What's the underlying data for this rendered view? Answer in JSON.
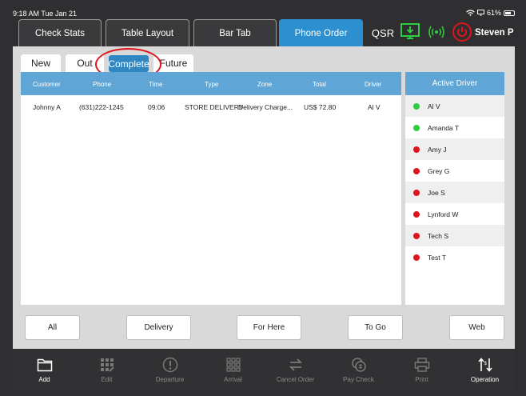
{
  "status_bar": {
    "time_date": "9:18 AM  Tue Jan 21",
    "battery": "61%"
  },
  "top_tabs": [
    {
      "label": "Check Stats",
      "active": false
    },
    {
      "label": "Table Layout",
      "active": false
    },
    {
      "label": "Bar Tab",
      "active": false
    },
    {
      "label": "Phone Order",
      "active": true
    }
  ],
  "qsr_label": "QSR",
  "user_name": "Steven P",
  "sub_tabs": [
    {
      "label": "New",
      "active": false
    },
    {
      "label": "Out",
      "active": false
    },
    {
      "label": "Complete",
      "active": true
    },
    {
      "label": "Future",
      "active": false
    }
  ],
  "orders_table": {
    "headers": [
      "Customer",
      "Phone",
      "Time",
      "Type",
      "Zone",
      "Total",
      "Driver"
    ],
    "rows": [
      [
        "Johnny A",
        "(631)222-1245",
        "09:06",
        "STORE DELIVERY",
        "Delivery Charge...",
        "US$ 72.80",
        "Al V"
      ]
    ]
  },
  "active_driver": {
    "title": "Active Driver",
    "drivers": [
      {
        "name": "Al V",
        "status": "active"
      },
      {
        "name": "Amanda T",
        "status": "active"
      },
      {
        "name": "Amy J",
        "status": "inactive"
      },
      {
        "name": "Grey G",
        "status": "inactive"
      },
      {
        "name": "Joe S",
        "status": "inactive"
      },
      {
        "name": "Lynford W",
        "status": "inactive"
      },
      {
        "name": "Tech S",
        "status": "inactive"
      },
      {
        "name": "Test T",
        "status": "inactive"
      }
    ]
  },
  "filter_buttons": [
    "All",
    "Delivery",
    "For Here",
    "To Go",
    "Web"
  ],
  "toolbar": [
    {
      "label": "Add",
      "icon": "folder-icon",
      "enabled": true
    },
    {
      "label": "Edit",
      "icon": "grid-edit-icon",
      "enabled": false
    },
    {
      "label": "Departure",
      "icon": "alert-circle-icon",
      "enabled": false
    },
    {
      "label": "Arrival",
      "icon": "grid-icon",
      "enabled": false
    },
    {
      "label": "Cancel Order",
      "icon": "swap-arrows-icon",
      "enabled": false
    },
    {
      "label": "Pay Check",
      "icon": "coins-icon",
      "enabled": false
    },
    {
      "label": "Print",
      "icon": "printer-icon",
      "enabled": false
    },
    {
      "label": "Operation",
      "icon": "sort-operation-icon",
      "enabled": true
    }
  ],
  "colors": {
    "accent_blue": "#2b8fd0",
    "header_blue": "#5fa6d6",
    "active_green": "#2ecc40",
    "inactive_red": "#e0141c",
    "highlight_circle": "#e0141c"
  }
}
